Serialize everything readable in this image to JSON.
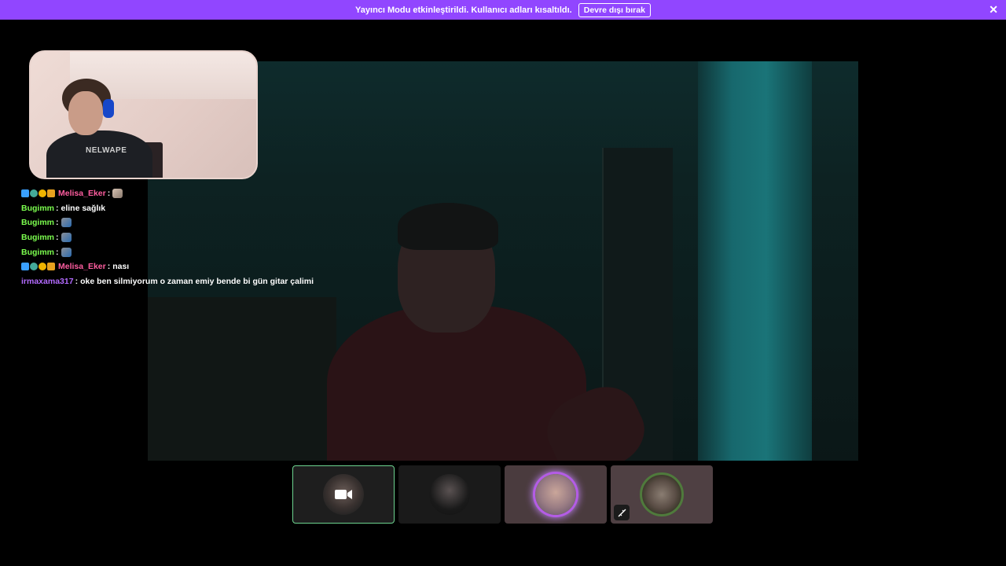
{
  "banner": {
    "message": "Yayıncı Modu etkinleştirildi. Kullanıcı adları kısaltıldı.",
    "disable_label": "Devre dışı bırak",
    "close_icon": "close-icon"
  },
  "chat": {
    "messages": [
      {
        "user": "Melisa_Eker",
        "color": "#ff5ea0",
        "text": "",
        "emote": "cat-emote",
        "badges": true
      },
      {
        "user": "Bugimm",
        "color": "#7cff4f",
        "text": "eline sağlık",
        "emote": "",
        "badges": false
      },
      {
        "user": "Bugimm",
        "color": "#7cff4f",
        "text": "",
        "emote": "pepe-emote",
        "badges": false
      },
      {
        "user": "Bugimm",
        "color": "#7cff4f",
        "text": "",
        "emote": "pepe-emote",
        "badges": false
      },
      {
        "user": "Bugimm",
        "color": "#7cff4f",
        "text": "",
        "emote": "pepe-emote",
        "badges": false
      },
      {
        "user": "Melisa_Eker",
        "color": "#ff5ea0",
        "text": "nası",
        "emote": "",
        "badges": true
      },
      {
        "user": "irmaxama317",
        "color": "#b36bff",
        "text": "oke ben silmiyorum o zaman emiy bende bi gün gitar çalimi",
        "emote": "",
        "badges": false
      }
    ],
    "separator": ":"
  },
  "shirt_text": "NELWAPE",
  "tiles": [
    {
      "name": "camera-tile",
      "icon": "video-camera-icon"
    },
    {
      "name": "participant-tile-2"
    },
    {
      "name": "participant-tile-3"
    },
    {
      "name": "participant-tile-4",
      "icon": "muted-icon"
    }
  ],
  "colors": {
    "banner": "#9146ff",
    "active_border": "#6dd38f",
    "speaking_glow": "#c88bff"
  }
}
